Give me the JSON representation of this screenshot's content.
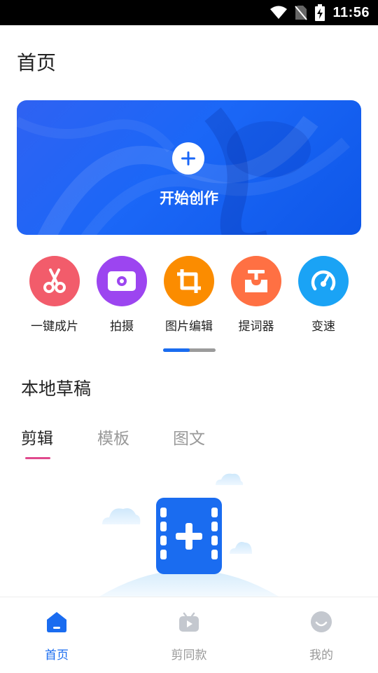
{
  "status_bar": {
    "time": "11:56"
  },
  "page_title": "首页",
  "hero": {
    "label": "开始创作"
  },
  "tools": [
    {
      "label": "一键成片",
      "icon": "scissors-icon",
      "color": "#f25c6b"
    },
    {
      "label": "拍摄",
      "icon": "camera-icon",
      "color": "#9c45f0"
    },
    {
      "label": "图片编辑",
      "icon": "crop-icon",
      "color": "#fb8c00"
    },
    {
      "label": "提词器",
      "icon": "teleprompter-icon",
      "color": "#ff7043"
    },
    {
      "label": "变速",
      "icon": "speedometer-icon",
      "color": "#1aa3f5"
    }
  ],
  "drafts": {
    "title": "本地草稿",
    "tabs": [
      "剪辑",
      "模板",
      "图文"
    ],
    "active_tab": 0
  },
  "bottom_nav": [
    {
      "label": "首页",
      "icon": "home-icon",
      "active": true
    },
    {
      "label": "剪同款",
      "icon": "template-video-icon",
      "active": false
    },
    {
      "label": "我的",
      "icon": "profile-icon",
      "active": false
    }
  ],
  "colors": {
    "accent": "#1a6cf0",
    "tab_indicator": "#e04a8d",
    "hero": "#1b67f7"
  }
}
